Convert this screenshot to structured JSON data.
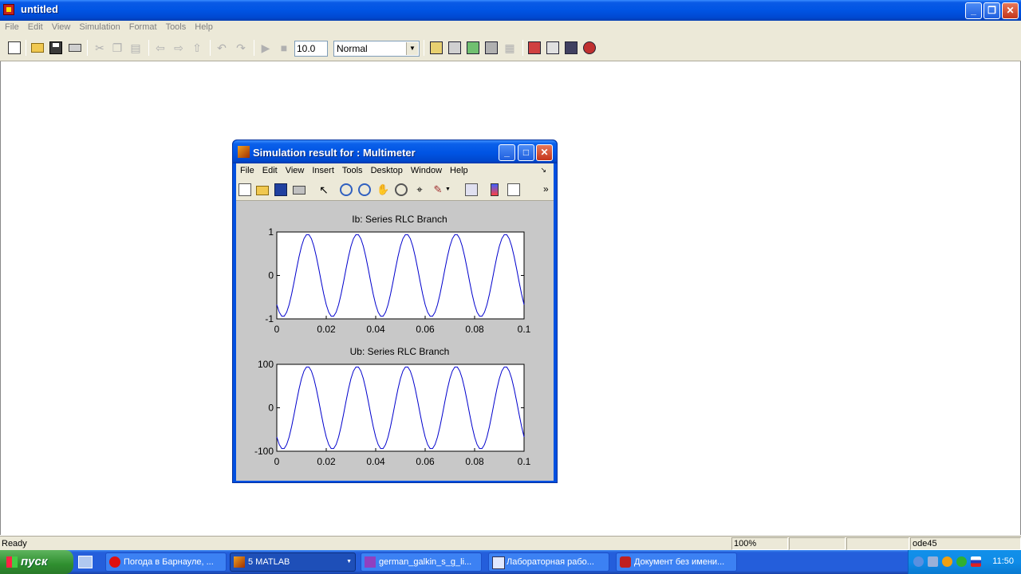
{
  "window": {
    "title": "untitled"
  },
  "menubar": [
    "File",
    "Edit",
    "View",
    "Simulation",
    "Format",
    "Tools",
    "Help"
  ],
  "toolbar": {
    "stop_time": "10.0",
    "sim_mode": "Normal"
  },
  "status": {
    "left": "Ready",
    "zoom": "100%",
    "solver": "ode45"
  },
  "figure": {
    "title": "Simulation result for : Multimeter",
    "menu": [
      "File",
      "Edit",
      "View",
      "Insert",
      "Tools",
      "Desktop",
      "Window",
      "Help"
    ]
  },
  "chart_data": [
    {
      "type": "line",
      "title": "Ib: Series RLC Branch",
      "xlim": [
        0,
        0.1
      ],
      "ylim": [
        -1,
        1
      ],
      "xticks": [
        "0",
        "0.02",
        "0.04",
        "0.06",
        "0.08",
        "0.1"
      ],
      "yticks": [
        "-1",
        "0",
        "1"
      ],
      "line_color": "#0000cc",
      "series": [
        {
          "signal": "sine",
          "frequency_hz": 50,
          "amplitude": 0.95,
          "phase_deg": -135
        }
      ]
    },
    {
      "type": "line",
      "title": "Ub: Series RLC Branch",
      "xlim": [
        0,
        0.1
      ],
      "ylim": [
        -100,
        100
      ],
      "xticks": [
        "0",
        "0.02",
        "0.04",
        "0.06",
        "0.08",
        "0.1"
      ],
      "yticks": [
        "-100",
        "0",
        "100"
      ],
      "line_color": "#0000cc",
      "series": [
        {
          "signal": "sine",
          "frequency_hz": 50,
          "amplitude": 95,
          "phase_deg": -135
        }
      ]
    }
  ],
  "taskbar": {
    "start": "пуск",
    "tasks": [
      {
        "label": "Погода в Барнауле, ...",
        "active": false
      },
      {
        "label": "5 MATLAB",
        "active": true
      },
      {
        "label": "german_galkin_s_g_li...",
        "active": false
      },
      {
        "label": "Лабораторная рабо...",
        "active": false
      },
      {
        "label": "Документ без имени...",
        "active": false
      }
    ],
    "clock": "11:50"
  }
}
